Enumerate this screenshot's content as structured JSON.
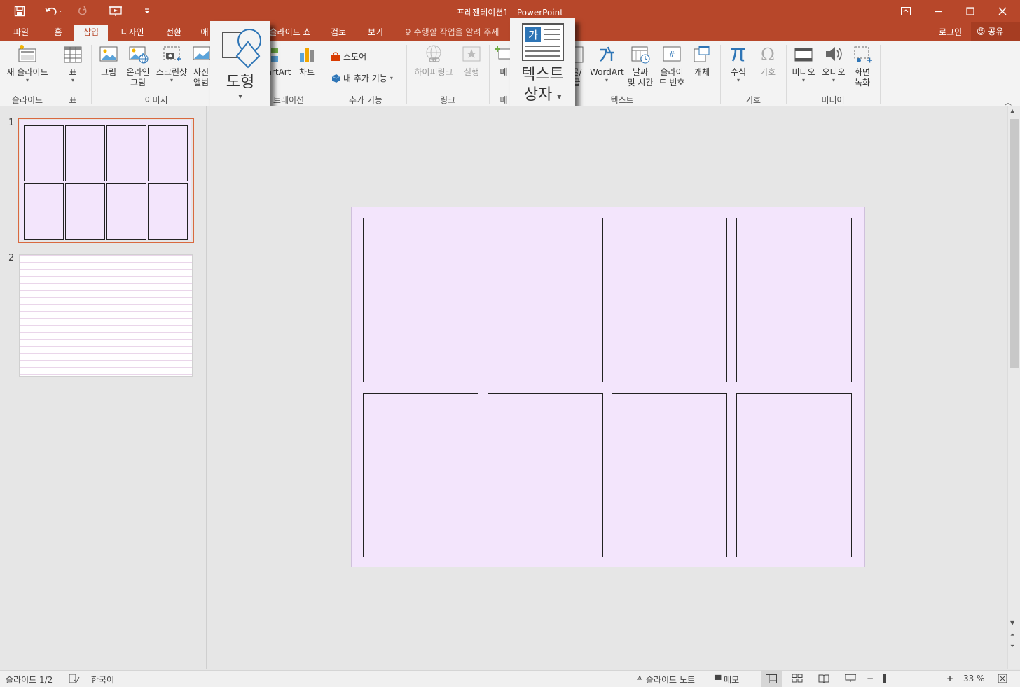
{
  "window": {
    "title": "프레젠테이션1 - PowerPoint",
    "accent_color": "#b7472a"
  },
  "qat": {
    "icons": [
      "save-icon",
      "undo-icon",
      "redo-icon",
      "start-from-beginning-icon",
      "customize-qat-icon"
    ]
  },
  "tabs": [
    {
      "label": "파일"
    },
    {
      "label": "홈"
    },
    {
      "label": "삽입",
      "active": true
    },
    {
      "label": "디자인"
    },
    {
      "label": "전환"
    },
    {
      "label": "애"
    },
    {
      "label": "슬라이드 쇼"
    },
    {
      "label": "검토"
    },
    {
      "label": "보기"
    }
  ],
  "tellme": "수행할 작업을 알려 주세",
  "account": {
    "login": "로그인",
    "share": "공유"
  },
  "ribbon": {
    "slides": {
      "new_slide": "새 슬라이드",
      "group": "슬라이드"
    },
    "tables": {
      "table": "표",
      "group": "표"
    },
    "images": {
      "picture": "그림",
      "online_line1": "온라인",
      "online_line2": "그림",
      "screenshot": "스크린샷",
      "album_line1": "사진",
      "album_line2": "앨범",
      "group": "이미지"
    },
    "illustrations": {
      "smartart": "artArt",
      "chart": "차트",
      "group": "트레이션"
    },
    "addins": {
      "store": "스토어",
      "my_addins": "내 추가 기능",
      "group": "추가 기능"
    },
    "links": {
      "hyperlink": "하이퍼링크",
      "action": "실행",
      "group": "링크"
    },
    "comments": {
      "comment": "메",
      "group": "메"
    },
    "text": {
      "header_line1": "글/",
      "header_line2": "글",
      "wordart": "WordArt",
      "datetime_line1": "날짜",
      "datetime_line2": "및 시간",
      "slidenum_line1": "슬라이",
      "slidenum_line2": "드 번호",
      "object": "개체",
      "group": "텍스트"
    },
    "symbols": {
      "equation": "수식",
      "symbol": "기호",
      "group": "기호"
    },
    "media": {
      "video": "비디오",
      "audio": "오디오",
      "record_line1": "화면",
      "record_line2": "녹화",
      "group": "미디어"
    }
  },
  "zoom_popups": {
    "shapes": {
      "label": "도형"
    },
    "textbox": {
      "label_line1": "텍스트",
      "label_line2": "상자"
    }
  },
  "slides": {
    "thumbnails": [
      {
        "number": "1",
        "selected": true
      },
      {
        "number": "2",
        "selected": false
      }
    ],
    "fill_color": "#f3e5fc",
    "grid_rows": 2,
    "grid_cols": 4
  },
  "status": {
    "slide_info": "슬라이드 1/2",
    "language": "한국어",
    "notes": "슬라이드 노트",
    "comments": "메모",
    "zoom": "33 %"
  }
}
